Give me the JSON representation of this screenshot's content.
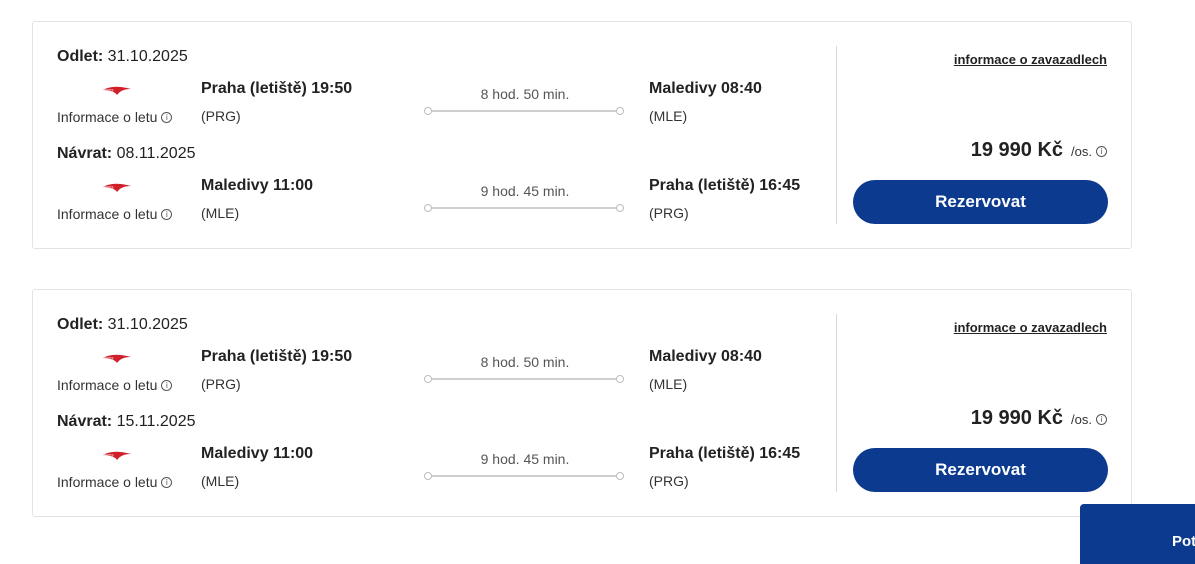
{
  "results": [
    {
      "outbound": {
        "label": "Odlet:",
        "date": "31.10.2025",
        "flight_info": "Informace o letu",
        "dep_place": "Praha (letiště) 19:50",
        "dep_code": "(PRG)",
        "duration": "8 hod. 50 min.",
        "arr_place": "Maledivy 08:40",
        "arr_code": "(MLE)"
      },
      "return": {
        "label": "Návrat:",
        "date": "08.11.2025",
        "flight_info": "Informace o letu",
        "dep_place": "Maledivy 11:00",
        "dep_code": "(MLE)",
        "duration": "9 hod. 45 min.",
        "arr_place": "Praha (letiště) 16:45",
        "arr_code": "(PRG)"
      },
      "baggage_link": "informace o zavazadlech",
      "price": "19 990 Kč",
      "per_person": "/os.",
      "book_label": "Rezervovat"
    },
    {
      "outbound": {
        "label": "Odlet:",
        "date": "31.10.2025",
        "flight_info": "Informace o letu",
        "dep_place": "Praha (letiště) 19:50",
        "dep_code": "(PRG)",
        "duration": "8 hod. 50 min.",
        "arr_place": "Maledivy 08:40",
        "arr_code": "(MLE)"
      },
      "return": {
        "label": "Návrat:",
        "date": "15.11.2025",
        "flight_info": "Informace o letu",
        "dep_place": "Maledivy 11:00",
        "dep_code": "(MLE)",
        "duration": "9 hod. 45 min.",
        "arr_place": "Praha (letiště) 16:45",
        "arr_code": "(PRG)"
      },
      "baggage_link": "informace o zavazadlech",
      "price": "19 990 Kč",
      "per_person": "/os.",
      "book_label": "Rezervovat"
    }
  ],
  "corner_button": "Pot",
  "icons": {
    "info": "info-icon",
    "airline": "airline-logo",
    "route_dot": "route-dot"
  },
  "colors": {
    "primary": "#0b3a8f",
    "logo_red": "#d0202a"
  }
}
